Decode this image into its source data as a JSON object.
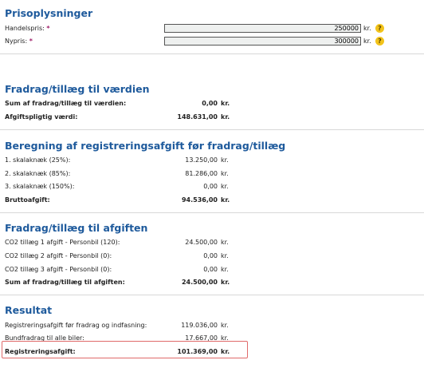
{
  "prisoplysninger": {
    "title": "Prisoplysninger",
    "handelspris_label": "Handelspris:",
    "handelspris_value": "250000",
    "nypris_label": "Nypris:",
    "nypris_value": "300000",
    "required_mark": "*",
    "unit": "kr.",
    "help": "?"
  },
  "fradrag_vaerdi": {
    "title": "Fradrag/tillæg til værdien",
    "rows": [
      {
        "label": "Sum af fradrag/tillæg til værdien:",
        "value": "0,00",
        "unit": "kr."
      },
      {
        "label": "Afgiftspligtig værdi:",
        "value": "148.631,00",
        "unit": "kr."
      }
    ]
  },
  "beregning": {
    "title": "Beregning af registreringsafgift før fradrag/tillæg",
    "rows": [
      {
        "label": "1. skalaknæk (25%):",
        "value": "13.250,00",
        "unit": "kr."
      },
      {
        "label": "2. skalaknæk (85%):",
        "value": "81.286,00",
        "unit": "kr."
      },
      {
        "label": "3. skalaknæk (150%):",
        "value": "0,00",
        "unit": "kr."
      },
      {
        "label": "Bruttoafgift:",
        "value": "94.536,00",
        "unit": "kr."
      }
    ]
  },
  "fradrag_afgift": {
    "title": "Fradrag/tillæg til afgiften",
    "rows": [
      {
        "label": "CO2 tillæg 1 afgift - Personbil (120):",
        "value": "24.500,00",
        "unit": "kr."
      },
      {
        "label": "CO2 tillæg 2 afgift - Personbil (0):",
        "value": "0,00",
        "unit": "kr."
      },
      {
        "label": "CO2 tillæg 3 afgift - Personbil (0):",
        "value": "0,00",
        "unit": "kr."
      },
      {
        "label": "Sum af fradrag/tillæg til afgiften:",
        "value": "24.500,00",
        "unit": "kr."
      }
    ]
  },
  "resultat": {
    "title": "Resultat",
    "rows": [
      {
        "label": "Registreringsafgift før fradrag og indfasning:",
        "value": "119.036,00",
        "unit": "kr."
      },
      {
        "label": "Bundfradrag til alle biler:",
        "value": "17.667,00",
        "unit": "kr."
      },
      {
        "label": "Registreringsafgift:",
        "value": "101.369,00",
        "unit": "kr."
      }
    ]
  }
}
